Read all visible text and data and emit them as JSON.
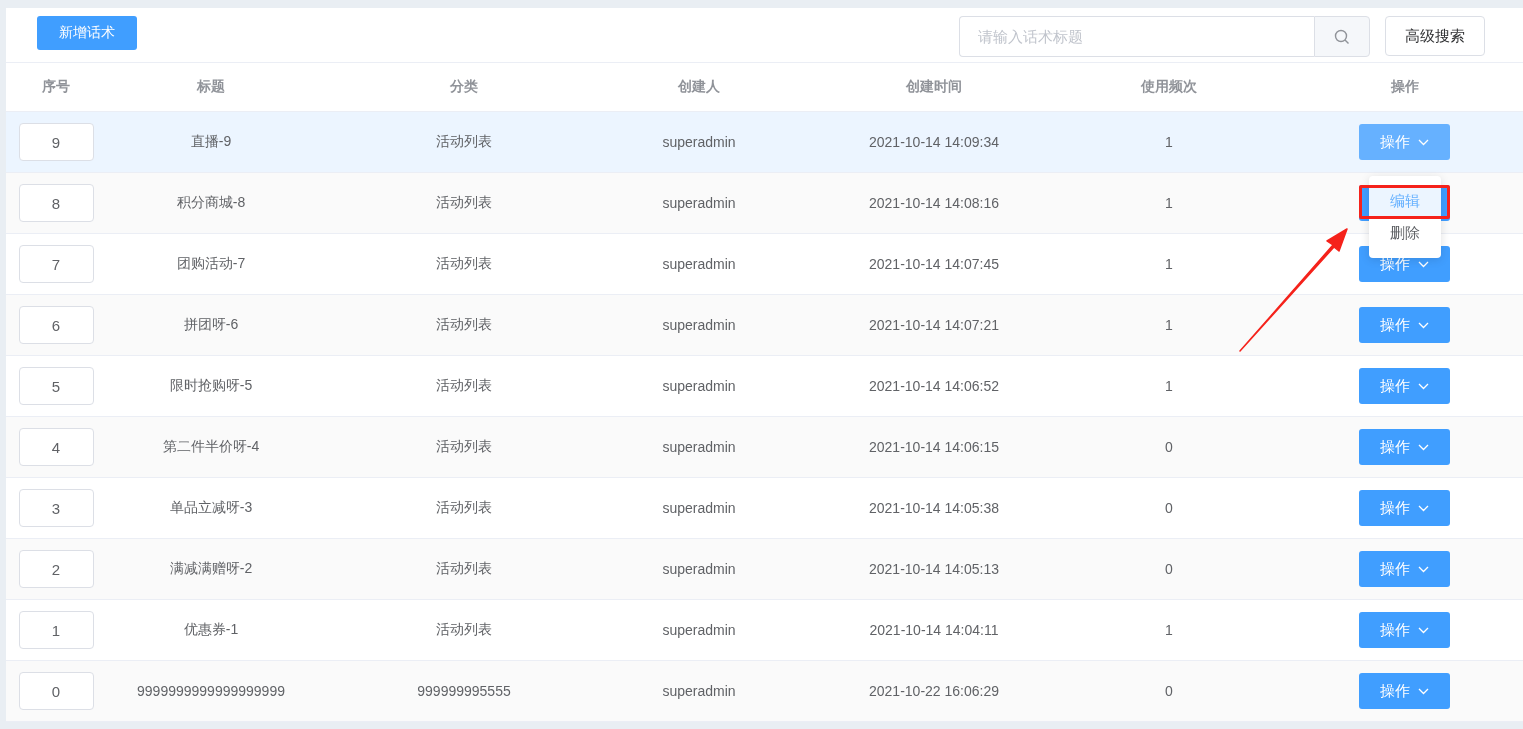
{
  "toolbar": {
    "add_button": "新增话术",
    "search": {
      "placeholder": "请输入话术标题"
    },
    "advanced_button": "高级搜索"
  },
  "table": {
    "columns": [
      "序号",
      "标题",
      "分类",
      "创建人",
      "创建时间",
      "使用频次",
      "操作"
    ],
    "rows": [
      {
        "order": "9",
        "title": "直播-9",
        "category": "活动列表",
        "creator": "superadmin",
        "created": "2021-10-14 14:09:34",
        "uses": "1",
        "action": "操作",
        "hovered": true
      },
      {
        "order": "8",
        "title": "积分商城-8",
        "category": "活动列表",
        "creator": "superadmin",
        "created": "2021-10-14 14:08:16",
        "uses": "1",
        "hovered": false
      },
      {
        "order": "7",
        "title": "团购活动-7",
        "category": "活动列表",
        "creator": "superadmin",
        "created": "2021-10-14 14:07:45",
        "uses": "1",
        "action": "操作",
        "hovered": false
      },
      {
        "order": "6",
        "title": "拼团呀-6",
        "category": "活动列表",
        "creator": "superadmin",
        "created": "2021-10-14 14:07:21",
        "uses": "1",
        "action": "操作",
        "hovered": false
      },
      {
        "order": "5",
        "title": "限时抢购呀-5",
        "category": "活动列表",
        "creator": "superadmin",
        "created": "2021-10-14 14:06:52",
        "uses": "1",
        "action": "操作",
        "hovered": false
      },
      {
        "order": "4",
        "title": "第二件半价呀-4",
        "category": "活动列表",
        "creator": "superadmin",
        "created": "2021-10-14 14:06:15",
        "uses": "0",
        "action": "操作",
        "hovered": false
      },
      {
        "order": "3",
        "title": "单品立减呀-3",
        "category": "活动列表",
        "creator": "superadmin",
        "created": "2021-10-14 14:05:38",
        "uses": "0",
        "action": "操作",
        "hovered": false
      },
      {
        "order": "2",
        "title": "满减满赠呀-2",
        "category": "活动列表",
        "creator": "superadmin",
        "created": "2021-10-14 14:05:13",
        "uses": "0",
        "action": "操作",
        "hovered": false
      },
      {
        "order": "1",
        "title": "优惠券-1",
        "category": "活动列表",
        "creator": "superadmin",
        "created": "2021-10-14 14:04:11",
        "uses": "1",
        "action": "操作",
        "hovered": false
      },
      {
        "order": "0",
        "title": "9999999999999999999",
        "category": "999999995555",
        "creator": "superadmin",
        "created": "2021-10-22 16:06:29",
        "uses": "0",
        "action": "操作",
        "hovered": false
      }
    ]
  },
  "dropdown": {
    "items": [
      {
        "label": "编辑",
        "highlighted": true
      },
      {
        "label": "删除",
        "highlighted": false
      }
    ]
  }
}
